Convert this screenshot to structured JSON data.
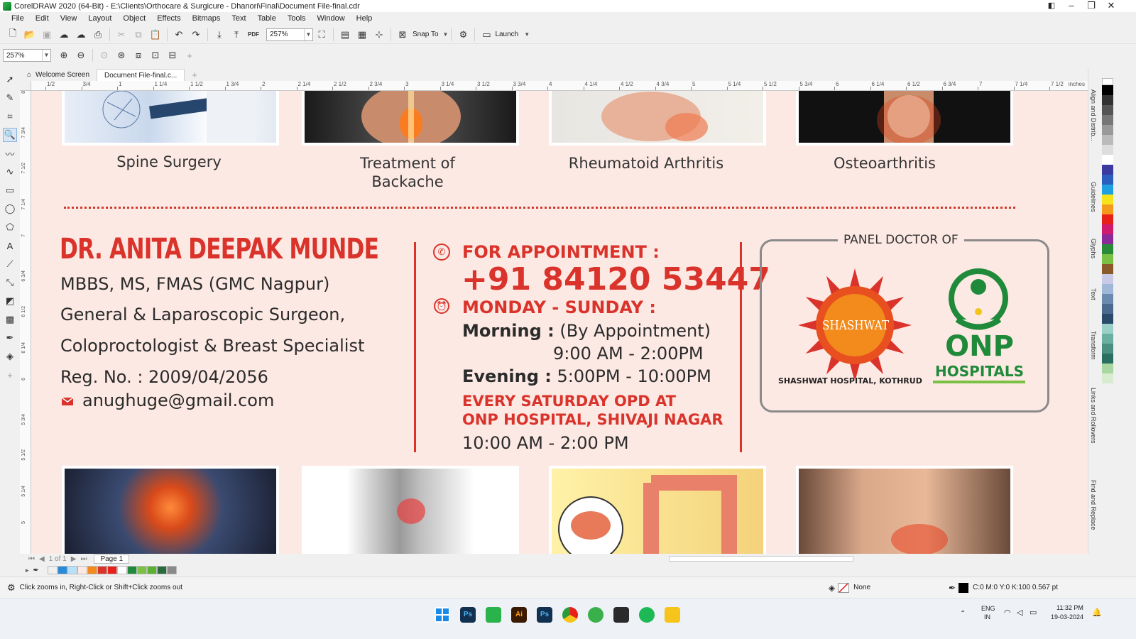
{
  "window": {
    "title": "CorelDRAW 2020 (64-Bit) - E:\\Clients\\Orthocare & Surgicure - Dhanori\\Final\\Document File-final.cdr"
  },
  "menu": [
    "File",
    "Edit",
    "View",
    "Layout",
    "Object",
    "Effects",
    "Bitmaps",
    "Text",
    "Table",
    "Tools",
    "Window",
    "Help"
  ],
  "toolbar": {
    "zoom_value": "257%",
    "snap_label": "Snap To",
    "launch_label": "Launch",
    "zoom_value_2": "257%",
    "pdf_label": "PDF"
  },
  "tabs": {
    "welcome": "Welcome Screen",
    "document": "Document File-final.c..."
  },
  "ruler": {
    "h_ticks": [
      "1/2",
      "3/4",
      "1",
      "1 1/4",
      "1 1/2",
      "1 3/4",
      "2",
      "2 1/4",
      "2 1/2",
      "2 3/4",
      "3",
      "3 1/4",
      "3 1/2",
      "3 3/4",
      "4",
      "4 1/4",
      "4 1/2",
      "4 3/4",
      "5",
      "5 1/4",
      "5 1/2",
      "5 3/4",
      "6",
      "6 1/4",
      "6 1/2",
      "6 3/4",
      "7",
      "7 1/4",
      "7 1/2"
    ],
    "unit": "inches",
    "v_ticks": [
      "8",
      "7 3/4",
      "7 1/2",
      "7 1/4",
      "7",
      "6 3/4",
      "6 1/2",
      "6 1/4",
      "6",
      "5 3/4",
      "5 1/2",
      "5 1/4",
      "5"
    ]
  },
  "design": {
    "services_top": [
      "Spine Surgery",
      "Treatment of",
      "Backache",
      "Rheumatoid Arthritis",
      "Osteoarthritis"
    ],
    "doctor": {
      "name": "DR. ANITA DEEPAK MUNDE",
      "degrees": "MBBS, MS, FMAS (GMC Nagpur)",
      "title1": "General & Laparoscopic Surgeon,",
      "title2": "Coloproctologist & Breast Specialist",
      "reg": "Reg. No. : 2009/04/2056",
      "email": "anughuge@gmail.com"
    },
    "appointment": {
      "heading": "FOR APPOINTMENT :",
      "phone": "+91 84120 53447",
      "days": "MONDAY - SUNDAY :",
      "morning_label": "Morning :",
      "morning_note": "(By Appointment)",
      "morning_time": "9:00 AM - 2:00PM",
      "evening_label": "Evening :",
      "evening_time": "5:00PM - 10:00PM",
      "saturday1": "EVERY SATURDAY OPD AT",
      "saturday2": "ONP HOSPITAL, SHIVAJI NAGAR",
      "saturday_time": "10:00 AM - 2:00 PM"
    },
    "panel": {
      "label": "PANEL DOCTOR OF",
      "shashwat_logo": "SHASHWAT",
      "shashwat_caption": "SHASHWAT HOSPITAL, KOTHRUD",
      "onp_logo": "ONP",
      "onp_sub": "HOSPITALS"
    }
  },
  "dockers": [
    "Align and Distrib...",
    "Guidelines",
    "Glyphs",
    "Text",
    "Transform",
    "Links and Rollovers",
    "Find and Replace"
  ],
  "page_nav": {
    "pages": "1 of 1",
    "page_tab": "Page 1"
  },
  "status": {
    "hint": "Click zooms in, Right-Click or Shift+Click zooms out",
    "fill": "None",
    "outline": "C:0 M:0 Y:0 K:100  0.567 pt"
  },
  "taskbar": {
    "lang1": "ENG",
    "lang2": "IN",
    "time": "11:32 PM",
    "date": "19-03-2024"
  },
  "colors": {
    "canvas_bg": "#fde9e3",
    "brand_red": "#d9332b",
    "onp_green": "#1f8a3a",
    "shashwat_orange": "#f28a1c"
  }
}
